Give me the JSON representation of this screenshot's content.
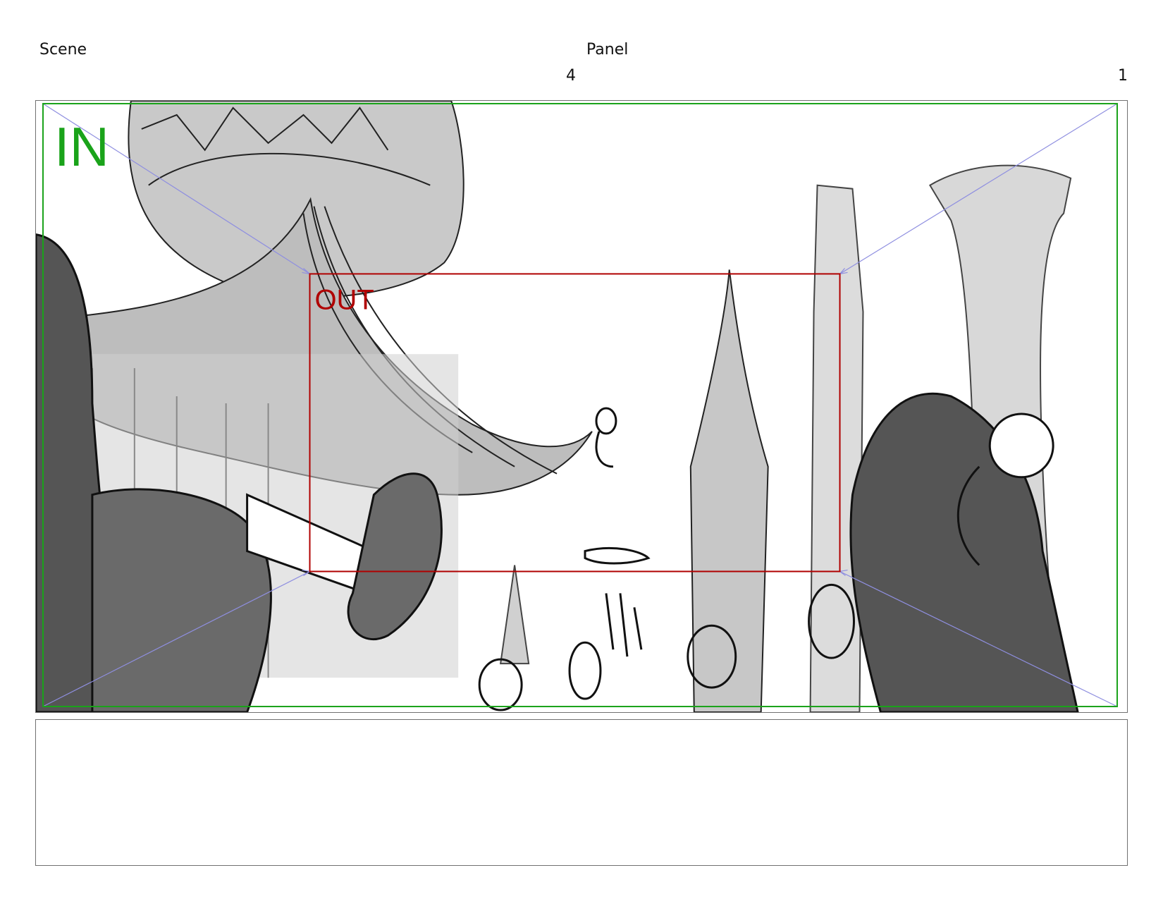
{
  "header": {
    "scene_label": "Scene",
    "panel_label": "Panel",
    "scene_number": "4",
    "panel_number": "1"
  },
  "frame": {
    "in_label": "IN",
    "out_label": "OUT",
    "in_color": "#1aa31a",
    "out_color": "#b00000",
    "camera_path_color": "#8f8fe0"
  },
  "notes": {
    "text": ""
  }
}
